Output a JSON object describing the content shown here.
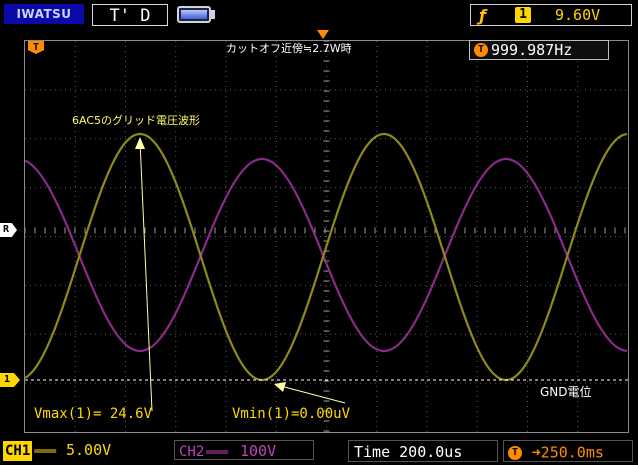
{
  "header": {
    "brand": "IWATSU",
    "trigger_state": "T' D",
    "battery_icon": "battery-icon",
    "trigger_edge_icon": "rising-edge-icon",
    "trigger_source": "1",
    "trigger_level": "9.60V"
  },
  "screen": {
    "trigger_pos_marker": "T",
    "ref_marker": "R",
    "ch1_marker": "1",
    "frequency_marker": "T",
    "frequency": "999.987Hz",
    "annotation_top": "カットオフ近傍≒2.7W時",
    "annotation_wave": "6AC5のグリッド電圧波形",
    "annotation_gnd": "GND電位",
    "vmax": "Vmax(1)= 24.6V",
    "vmin": "Vmin(1)=0.00uV"
  },
  "footer": {
    "ch1_label": "CH1",
    "ch1_coupling": "═══",
    "ch1_scale": "5.00V",
    "ch2_label": "CH2",
    "ch2_coupling": "═══",
    "ch2_scale": "100V",
    "timebase": "Time 200.0us",
    "delay_marker": "T",
    "delay": "➜250.0ms"
  },
  "colors": {
    "ch1": "#ffd700",
    "ch1_trace": "#8f8a1a",
    "ch2": "#c040c0",
    "ch2_trace": "#8a2a8a",
    "trigger": "#ff8c00",
    "brand_bg": "#0a0aa8"
  }
}
